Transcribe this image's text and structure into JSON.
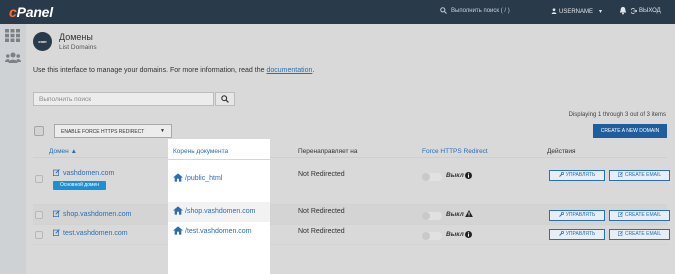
{
  "header": {
    "logo_c": "c",
    "logo_rest": "Panel",
    "search_placeholder": "Выполнить поиск ( / )",
    "username": "USERNAME",
    "logout": "ВЫХОД"
  },
  "page": {
    "icon_text": "com",
    "title": "Домены",
    "subtitle": "List Domains",
    "intro_text": "Use this interface to manage your domains. For more information, read the ",
    "intro_link": "documentation",
    "intro_end": "."
  },
  "toolbar": {
    "filter_placeholder": "Выполнить поиск",
    "displaying": "Displaying 1 through 3 out of 3 items",
    "bulk_action": "ENABLE FORCE HTTPS REDIRECT",
    "create_button": "CREATE A NEW DOMAIN"
  },
  "table": {
    "columns": {
      "domain": "Домен",
      "doc_root": "Корень документа",
      "redirects": "Перенаправляет на",
      "https": "Force HTTPS Redirect",
      "actions": "Действия"
    },
    "main_badge": "Основной домен",
    "manage_label": "УПРАВЛЯТЬ",
    "email_label": "CREATE EMAIL",
    "rows": [
      {
        "domain": "vashdomen.com",
        "root": "/public_html",
        "redirect": "Not Redirected",
        "https": "Выкл",
        "state_icon": "info-icon"
      },
      {
        "domain": "shop.vashdomen.com",
        "root": "/shop.vashdomen.com",
        "redirect": "Not Redirected",
        "https": "Выкл",
        "state_icon": "warning-icon"
      },
      {
        "domain": "test.vashdomen.com",
        "root": "/test.vashdomen.com",
        "redirect": "Not Redirected",
        "https": "Выкл",
        "state_icon": "info-icon"
      }
    ]
  },
  "colors": {
    "header_bg": "#293a4a",
    "logo_accent": "#ff6c2c",
    "link": "#2a6eb5",
    "primary_button": "#1f5d9f",
    "badge": "#1e8fd0"
  }
}
